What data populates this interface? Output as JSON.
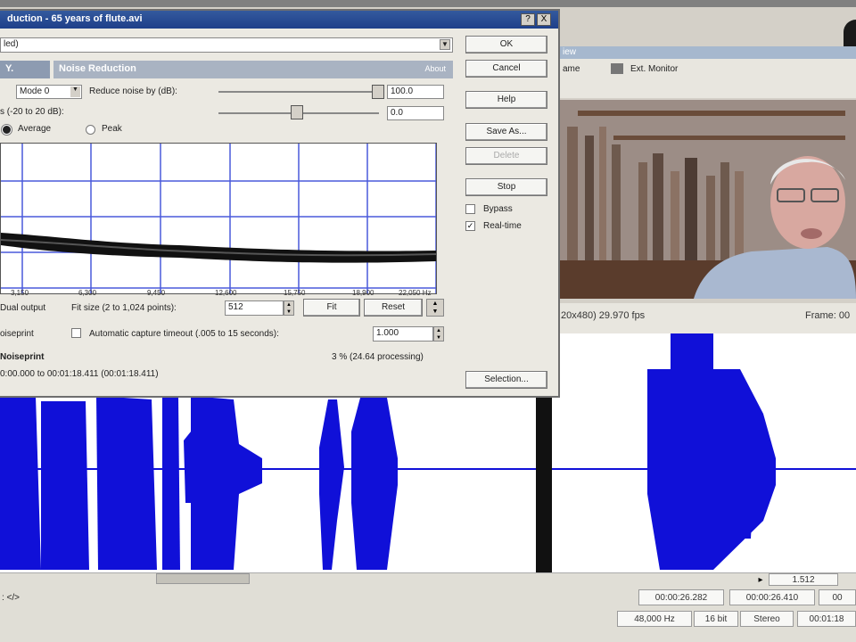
{
  "dialog": {
    "title": "duction - 65 years of flute.avi",
    "preset": "led)",
    "help_glyph": "?",
    "close_glyph": "X",
    "tab_label": "Y.",
    "panel_title": "Noise Reduction",
    "panel_about": "About",
    "mode_label": "",
    "mode_value": "Mode 0",
    "reduce_label": "Reduce noise by (dB):",
    "reduce_value": "100.0",
    "range_label": "s (-20 to 20 dB):",
    "range_value": "0.0",
    "radio_average": "Average",
    "radio_peak": "Peak",
    "x_ticks": [
      "3,150",
      "6,300",
      "9,450",
      "12,600",
      "15,750",
      "18,900",
      "22,050 Hz"
    ],
    "dual_output": "Dual output",
    "fft_label": "Fit size (2 to 1,024 points):",
    "fft_value": "512",
    "fit_button": "Fit",
    "reset_button": "Reset",
    "noiseprint_label": "oiseprint",
    "auto_capture_label": "Automatic capture timeout (.005 to 15 seconds):",
    "auto_capture_value": "1.000",
    "noiseprint_section": "Noiseprint",
    "progress": "3 %  (24.64 processing)",
    "range_text": "0:00.000 to 00:01:18.411 (00:01:18.411)",
    "buttons": {
      "ok": "OK",
      "cancel": "Cancel",
      "help": "Help",
      "save_as": "Save As...",
      "delete": "Delete",
      "stop": "Stop",
      "selection": "Selection..."
    },
    "bypass": "Bypass",
    "realtime": "Real-time"
  },
  "video_preview": {
    "header": "iew",
    "frame_btn": "ame",
    "ext_monitor": "Ext. Monitor",
    "resolution": "20x480)  29.970 fps",
    "frame_label": "Frame: 00"
  },
  "status_bar": {
    "cursor_value": "1.512",
    "sel_start": "00:00:26.282",
    "sel_end": "00:00:26.410",
    "sel_extra": "00",
    "sample_rate": "48,000 Hz",
    "bit_depth": "16 bit",
    "channels": "Stereo",
    "length": "00:01:18",
    "left_text": ":   </>"
  },
  "colors": {
    "waveform": "#1010d8",
    "graph_grid": "#4a5adc",
    "title_bar": "#1e3f8a"
  }
}
